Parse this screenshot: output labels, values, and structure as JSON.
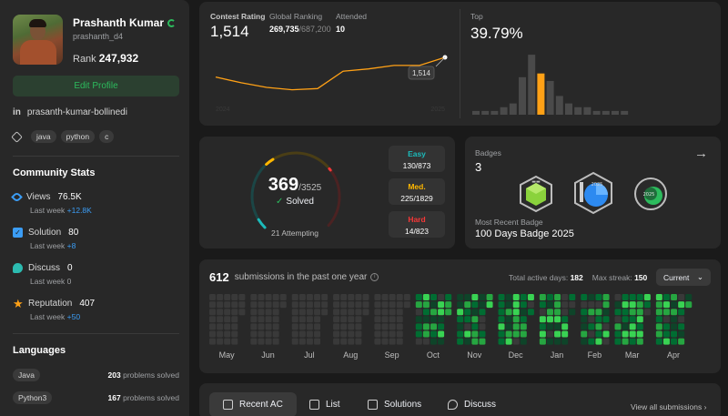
{
  "profile": {
    "name": "Prashanth Kumar",
    "username": "prashanth_d4",
    "rank_label": "Rank",
    "rank_value": "247,932",
    "edit_label": "Edit Profile",
    "linkedin": "prasanth-kumar-bollinedi",
    "skills": [
      "java",
      "python",
      "c"
    ]
  },
  "community": {
    "title": "Community Stats",
    "stats": [
      {
        "label": "Views",
        "value": "76.5K",
        "sub_label": "Last week",
        "delta": "+12.8K",
        "delta_color": "#3b9df5"
      },
      {
        "label": "Solution",
        "value": "80",
        "sub_label": "Last week",
        "delta": "+8",
        "delta_color": "#3b9df5"
      },
      {
        "label": "Discuss",
        "value": "0",
        "sub_label": "Last week",
        "delta": "0",
        "delta_color": "#9ea0a3"
      },
      {
        "label": "Reputation",
        "value": "407",
        "sub_label": "Last week",
        "delta": "+50",
        "delta_color": "#3b9df5"
      }
    ]
  },
  "languages": {
    "title": "Languages",
    "items": [
      {
        "name": "Java",
        "count": "203",
        "suffix": "problems solved"
      },
      {
        "name": "Python3",
        "count": "167",
        "suffix": "problems solved"
      }
    ]
  },
  "contest": {
    "rating_label": "Contest Rating",
    "rating_value": "1,514",
    "global_label": "Global Ranking",
    "global_value": "269,735",
    "global_total": "/687,200",
    "attended_label": "Attended",
    "attended_value": "10",
    "top_label": "Top",
    "top_value": "39.79%",
    "tooltip_value": "1,514",
    "year_start": "2024",
    "year_end": "2025",
    "accent": "#ffa116"
  },
  "chart_data": [
    {
      "type": "line",
      "title": "Contest Rating",
      "x": [
        "2024",
        "",
        "",
        "",
        "",
        "",
        "",
        "",
        "",
        "2025"
      ],
      "series": [
        {
          "values": [
            1480,
            1470,
            1462,
            1458,
            1460,
            1490,
            1494,
            1500,
            1500,
            1514
          ]
        }
      ],
      "xlabel": "",
      "ylabel": "",
      "ylim": [
        1440,
        1525
      ]
    },
    {
      "type": "bar",
      "title": "Top",
      "values": [
        1,
        1,
        1,
        2,
        3,
        10,
        16,
        11,
        9,
        5,
        3,
        2,
        2,
        1,
        1,
        1,
        1
      ],
      "highlight_index": 7,
      "highlight_color": "#ffa116",
      "ylim": [
        0,
        17
      ]
    },
    {
      "type": "heatmap",
      "title": "submissions in the past one year",
      "months": [
        "May",
        "Jun",
        "Jul",
        "Aug",
        "Sep",
        "Oct",
        "Nov",
        "Dec",
        "Jan",
        "Feb",
        "Mar",
        "Apr"
      ],
      "days_per_month": [
        31,
        30,
        31,
        31,
        30,
        31,
        30,
        31,
        31,
        28,
        31,
        30
      ],
      "active_from_month_index": 5,
      "colors": [
        "#393939",
        "#0e4429",
        "#006d32",
        "#26a641",
        "#39d353"
      ]
    }
  ],
  "solved": {
    "count": "369",
    "total": "/3525",
    "label": "Solved",
    "attempting": "21 Attempting",
    "ring_color": "#ffa116",
    "difficulties": [
      {
        "name": "Easy",
        "value": "130/873",
        "color": "#1cbaba",
        "fraction": 0.149
      },
      {
        "name": "Med.",
        "value": "225/1829",
        "color": "#ffb700",
        "fraction": 0.123
      },
      {
        "name": "Hard",
        "value": "14/823",
        "color": "#f63737",
        "fraction": 0.017
      }
    ]
  },
  "badges": {
    "label": "Badges",
    "count": "3",
    "recent_label": "Most Recent Badge",
    "recent_value": "100 Days Badge 2025",
    "items": [
      {
        "name": "50 Days Badge",
        "color": "#8ad23c",
        "icon": "hexagon-badge-icon"
      },
      {
        "name": "100 Days Badge 2025",
        "color": "#2d8af0",
        "icon": "circle-badge-icon",
        "year": "2025"
      },
      {
        "name": "50 Days Badge 2024",
        "color": "#2cbb5d",
        "icon": "wreath-badge-icon",
        "year": "2025"
      }
    ]
  },
  "heatmap": {
    "count": "612",
    "text": "submissions in the past one year",
    "active_label": "Total active days:",
    "active_value": "182",
    "streak_label": "Max streak:",
    "streak_value": "150",
    "select": "Current"
  },
  "tabs": {
    "items": [
      "Recent AC",
      "List",
      "Solutions",
      "Discuss"
    ],
    "view_all": "View all submissions"
  }
}
